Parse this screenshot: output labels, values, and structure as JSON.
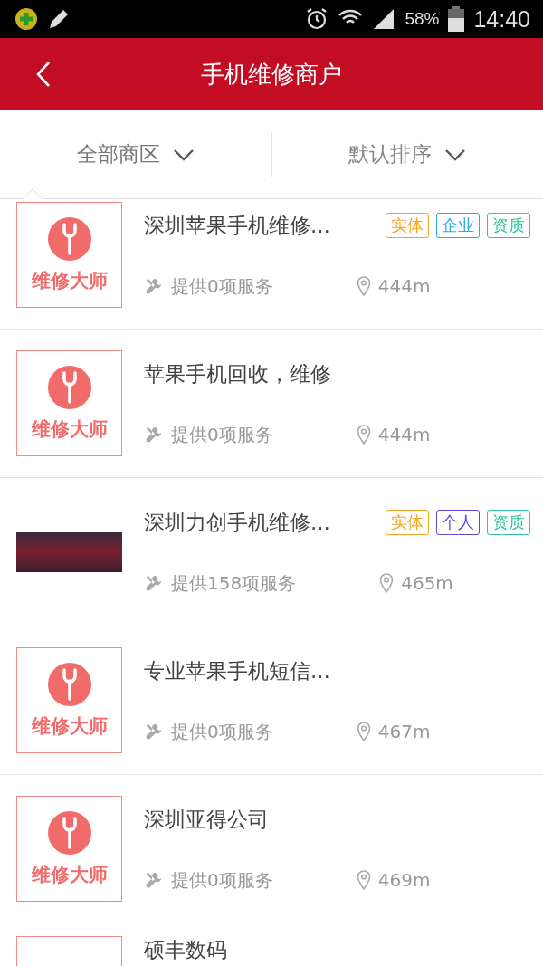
{
  "status_bar": {
    "battery": "58%",
    "time": "14:40"
  },
  "header": {
    "title": "手机维修商户"
  },
  "filters": [
    {
      "label": "全部商区",
      "selected": true
    },
    {
      "label": "默认排序",
      "selected": false
    }
  ],
  "merchants": [
    {
      "name": "深圳苹果手机维修...",
      "image": {
        "kind": "logo",
        "text": "维修大师"
      },
      "services": "提供0项服务",
      "distance": "444m",
      "tags": [
        {
          "label": "实体",
          "color": "#f5a623"
        },
        {
          "label": "企业",
          "color": "#29abe2"
        },
        {
          "label": "资质",
          "color": "#2ec4a0"
        }
      ]
    },
    {
      "name": "苹果手机回收，维修",
      "image": {
        "kind": "logo",
        "text": "维修大师"
      },
      "services": "提供0项服务",
      "distance": "444m"
    },
    {
      "name": "深圳力创手机维修...",
      "image": {
        "kind": "photo"
      },
      "services": "提供158项服务",
      "distance": "465m",
      "tags": [
        {
          "label": "实体",
          "color": "#f5a623"
        },
        {
          "label": "个人",
          "color": "#5b4ce0"
        },
        {
          "label": "资质",
          "color": "#2ec4a0"
        }
      ]
    },
    {
      "name": "专业苹果手机短信...",
      "image": {
        "kind": "logo",
        "text": "维修大师"
      },
      "services": "提供0项服务",
      "distance": "467m"
    },
    {
      "name": "深圳亚得公司",
      "image": {
        "kind": "logo",
        "text": "维修大师"
      },
      "services": "提供0项服务",
      "distance": "469m"
    },
    {
      "name": "硕丰数码",
      "image": {
        "kind": "logo"
      }
    }
  ]
}
